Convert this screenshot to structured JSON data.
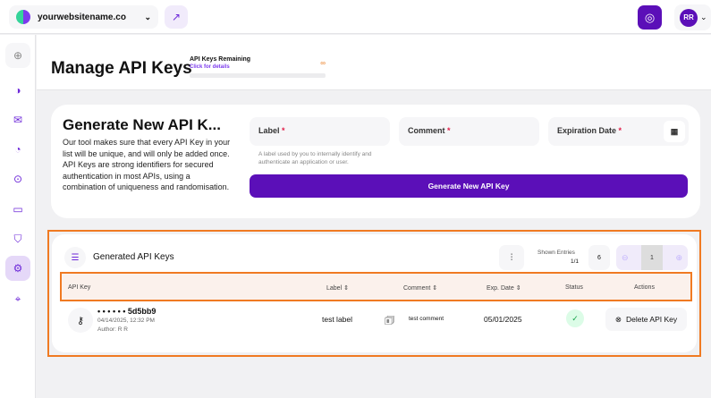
{
  "topbar": {
    "site": "yourwebsitename.co",
    "user_initials": "RR"
  },
  "sidebar": {
    "items": [
      "collapse",
      "analytics",
      "inbox",
      "progress",
      "scan",
      "chat",
      "shield",
      "settings",
      "location"
    ],
    "active": "settings"
  },
  "header": {
    "title": "Manage API Keys",
    "remaining_label": "API Keys Remaining",
    "details_link": "Click for details",
    "remaining_value": "∞"
  },
  "generate": {
    "title": "Generate New API K...",
    "description": "Our tool makes sure that every API Key in your list will be unique, and will only be added once. API Keys are strong identifiers for secured authentication in most APIs, using a combination of uniqueness and randomisation.",
    "label_field": "Label",
    "comment_field": "Comment",
    "expiration_field": "Expiration Date",
    "required_mark": "*",
    "hint": "A label used by you to internally identify and authenticate an application or user.",
    "button": "Generate New API Key"
  },
  "table": {
    "title": "Generated API Keys",
    "shown_entries_label": "Shown Entries",
    "shown_entries": "1/1",
    "page_size": "6",
    "page": "1",
    "columns": [
      "API Key",
      "Label",
      "Comment",
      "Exp. Date",
      "Status",
      "Actions"
    ],
    "rows": [
      {
        "key": "• • • • • • 5d5bb9",
        "created": "04/14/2025, 12:32 PM",
        "author": "Author: R R",
        "label": "test label",
        "comment": "test comment",
        "exp": "05/01/2025",
        "status": "active",
        "action": "Delete API Key"
      }
    ]
  },
  "colors": {
    "accent": "#5b0fb8",
    "highlight": "#f07a22"
  }
}
